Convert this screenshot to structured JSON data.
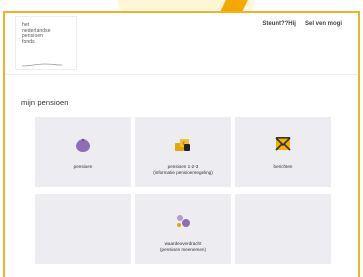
{
  "brand": {
    "logo_lines": [
      "het",
      "nederlandse",
      "pensioen",
      "fonds"
    ],
    "accent_color": "#f3b320",
    "wedge_color": "#f5a800",
    "tile_color": "#ececf1",
    "icon_colors": {
      "purse": "#8c6fb5",
      "coins": "#e5a800",
      "envelope": "#f0b400",
      "people": "#8c6fb5"
    }
  },
  "nav": {
    "help_link": "Steunt??Hij",
    "logout_link": "Sel ven mogi"
  },
  "main": {
    "section_title": "mijn pensioen",
    "tiles": [
      {
        "label_lines": [
          "pensioen"
        ],
        "icon": "purse-icon"
      },
      {
        "label_lines": [
          "pensioen 1-2-3",
          "(informatie pensioenregeling)"
        ],
        "icon": "coins-icon"
      },
      {
        "label_lines": [
          "berichten"
        ],
        "icon": "envelope-icon"
      },
      {
        "label_lines": [],
        "icon": ""
      },
      {
        "label_lines": [
          "waardeoverdracht",
          "(pensioen meenemen)"
        ],
        "icon": "people-icon"
      },
      {
        "label_lines": [],
        "icon": ""
      }
    ]
  }
}
